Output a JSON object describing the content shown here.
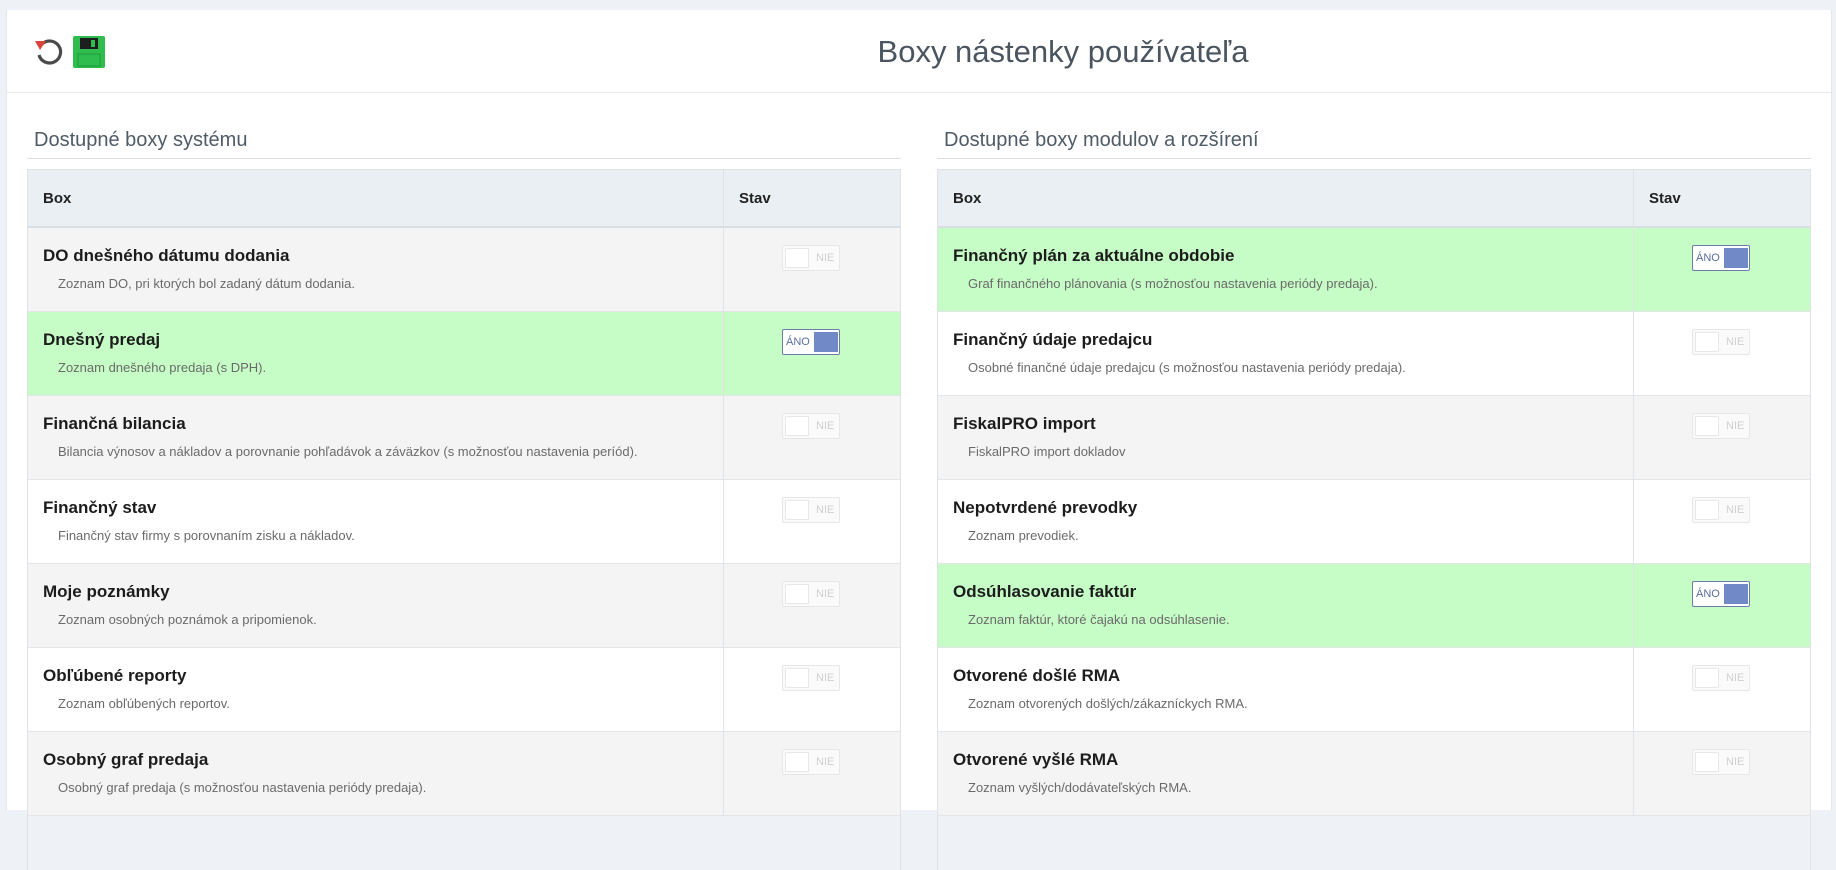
{
  "page": {
    "title": "Boxy nástenky používateľa"
  },
  "toolbar": {
    "undo_icon": "undo-icon",
    "save_icon": "save-icon"
  },
  "left": {
    "header": "Dostupné boxy systému",
    "col_box": "Box",
    "col_stav": "Stav",
    "rows": [
      {
        "title": "DO dnešného dátumu dodania",
        "desc": "Zoznam DO, pri ktorých bol zadaný dátum dodania.",
        "state": "NIE"
      },
      {
        "title": "Dnešný predaj",
        "desc": "Zoznam dnešného predaja (s DPH).",
        "state": "ÁNO"
      },
      {
        "title": "Finančná bilancia",
        "desc": "Bilancia výnosov a nákladov a porovnanie pohľadávok a záväzkov (s možnosťou nastavenia períód).",
        "state": "NIE"
      },
      {
        "title": "Finančný stav",
        "desc": "Finančný stav firmy s porovnaním zisku a nákladov.",
        "state": "NIE"
      },
      {
        "title": "Moje poznámky",
        "desc": "Zoznam osobných poznámok a pripomienok.",
        "state": "NIE"
      },
      {
        "title": "Obľúbené reporty",
        "desc": "Zoznam obľúbených reportov.",
        "state": "NIE"
      },
      {
        "title": "Osobný graf predaja",
        "desc": "Osobný graf predaja (s možnosťou nastavenia periódy predaja).",
        "state": "NIE"
      }
    ]
  },
  "right": {
    "header": "Dostupné boxy modulov a rozšírení",
    "col_box": "Box",
    "col_stav": "Stav",
    "rows": [
      {
        "title": "Finančný plán za aktuálne obdobie",
        "desc": "Graf finančného plánovania (s možnosťou nastavenia periódy predaja).",
        "state": "ÁNO"
      },
      {
        "title": "Finančný údaje predajcu",
        "desc": "Osobné finančné údaje predajcu (s možnosťou nastavenia periódy predaja).",
        "state": "NIE"
      },
      {
        "title": "FiskalPRO import",
        "desc": "FiskalPRO import dokladov",
        "state": "NIE"
      },
      {
        "title": "Nepotvrdené prevodky",
        "desc": "Zoznam prevodiek.",
        "state": "NIE"
      },
      {
        "title": "Odsúhlasovanie faktúr",
        "desc": "Zoznam faktúr, ktoré čajakú na odsúhlasenie.",
        "state": "ÁNO"
      },
      {
        "title": "Otvorené došlé RMA",
        "desc": "Zoznam otvorených došlých/zákazníckych RMA.",
        "state": "NIE"
      },
      {
        "title": "Otvorené vyšlé RMA",
        "desc": "Zoznam vyšlých/dodávateľských RMA.",
        "state": "NIE"
      }
    ]
  },
  "colors": {
    "active_row": "#c6fcc6",
    "toggle_on": "#7289c8",
    "save_green": "#2ebd4e",
    "undo_red": "#d9453b"
  }
}
